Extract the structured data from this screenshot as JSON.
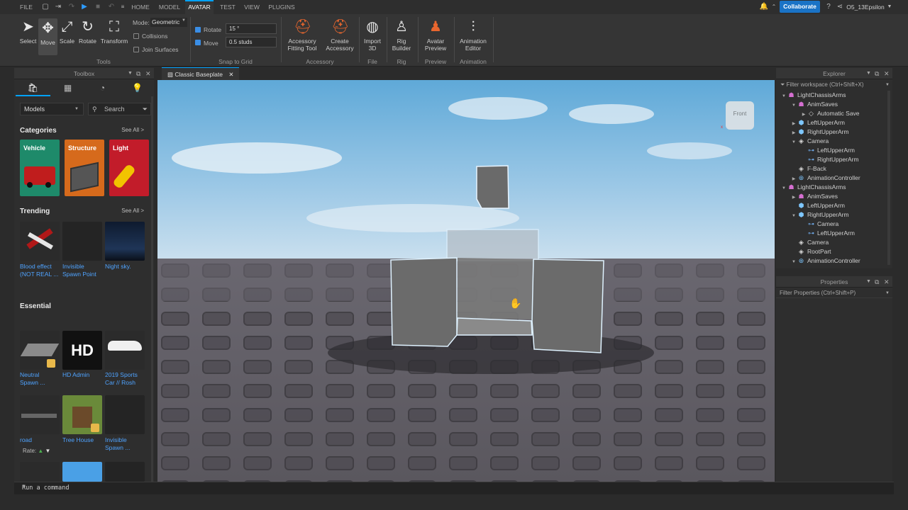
{
  "menubar": {
    "file": "FILE",
    "tabs": [
      "HOME",
      "MODEL",
      "AVATAR",
      "TEST",
      "VIEW",
      "PLUGINS"
    ],
    "active_tab": "AVATAR",
    "collaborate": "Collaborate",
    "user": "O5_13Epsilon"
  },
  "ribbon": {
    "tools": [
      {
        "label": "Select",
        "icon": "cursor-icon"
      },
      {
        "label": "Move",
        "icon": "move-icon"
      },
      {
        "label": "Scale",
        "icon": "scale-icon"
      },
      {
        "label": "Rotate",
        "icon": "rotate-icon"
      },
      {
        "label": "Transform",
        "icon": "transform-icon"
      }
    ],
    "mode_label": "Mode:",
    "mode_value": "Geometric",
    "collisions": "Collisions",
    "join_surfaces": "Join Surfaces",
    "tools_group": "Tools",
    "rotate_label": "Rotate",
    "rotate_value": "15 °",
    "move_label": "Move",
    "move_value": "0.5 studs",
    "snap_group": "Snap to Grid",
    "acc_fitting_1": "Accessory",
    "acc_fitting_2": "Fitting Tool",
    "create_acc_1": "Create",
    "create_acc_2": "Accessory",
    "accessory_group": "Accessory",
    "import_1": "Import",
    "import_2": "3D",
    "file_group": "File",
    "rig_1": "Rig",
    "rig_2": "Builder",
    "rig_group": "Rig",
    "preview_1": "Avatar",
    "preview_2": "Preview",
    "preview_group": "Preview",
    "anim_1": "Animation",
    "anim_2": "Editor",
    "animation_group": "Animation"
  },
  "toolbox": {
    "title": "Toolbox",
    "dropdown": "Models",
    "search_placeholder": "Search",
    "categories_title": "Categories",
    "see_all": "See All >",
    "categories": [
      {
        "label": "Vehicle",
        "color": "#1e8a6a"
      },
      {
        "label": "Structure",
        "color": "#d66a1c"
      },
      {
        "label": "Light",
        "color": "#c21c2a"
      }
    ],
    "trending_title": "Trending",
    "trending": [
      {
        "l1": "Blood effect",
        "l2": "(NOT REAL ..."
      },
      {
        "l1": "Invisible",
        "l2": "Spawn Point"
      },
      {
        "l1": "Night sky.",
        "l2": ""
      }
    ],
    "essential_title": "Essential",
    "essential": [
      {
        "l1": "Neutral",
        "l2": "Spawn ..."
      },
      {
        "l1": "HD Admin",
        "l2": ""
      },
      {
        "l1": "2019 Sports",
        "l2": "Car // Rosh"
      },
      {
        "l1": "road",
        "l2": ""
      },
      {
        "l1": "Tree House",
        "l2": ""
      },
      {
        "l1": "Invisible",
        "l2": "Spawn ..."
      }
    ],
    "rate_label": "Rate:",
    "hd_text": "HD"
  },
  "viewport": {
    "tab": "Classic Baseplate",
    "view_cube": "Front"
  },
  "explorer": {
    "title": "Explorer",
    "filter": "Filter workspace (Ctrl+Shift+X)",
    "rows": [
      {
        "label": "LightChassisArms",
        "indent": 0,
        "arrow": "▼",
        "icon": "model"
      },
      {
        "label": "AnimSaves",
        "indent": 1,
        "arrow": "▼",
        "icon": "model"
      },
      {
        "label": "Automatic Save",
        "indent": 2,
        "arrow": "▶",
        "icon": "keyframe"
      },
      {
        "label": "LeftUpperArm",
        "indent": 1,
        "arrow": "▶",
        "icon": "mesh"
      },
      {
        "label": "RightUpperArm",
        "indent": 1,
        "arrow": "▶",
        "icon": "mesh"
      },
      {
        "label": "Camera",
        "indent": 1,
        "arrow": "▼",
        "icon": "part"
      },
      {
        "label": "LeftUpperArm",
        "indent": 2,
        "arrow": "",
        "icon": "link"
      },
      {
        "label": "RightUpperArm",
        "indent": 2,
        "arrow": "",
        "icon": "link"
      },
      {
        "label": "F-Back",
        "indent": 1,
        "arrow": "",
        "icon": "part"
      },
      {
        "label": "AnimationController",
        "indent": 1,
        "arrow": "▶",
        "icon": "anim"
      },
      {
        "label": "LightChassisArms",
        "indent": 0,
        "arrow": "▼",
        "icon": "model"
      },
      {
        "label": "AnimSaves",
        "indent": 1,
        "arrow": "▶",
        "icon": "model"
      },
      {
        "label": "LeftUpperArm",
        "indent": 1,
        "arrow": "",
        "icon": "mesh"
      },
      {
        "label": "RightUpperArm",
        "indent": 1,
        "arrow": "▼",
        "icon": "mesh"
      },
      {
        "label": "Camera",
        "indent": 2,
        "arrow": "",
        "icon": "link"
      },
      {
        "label": "LeftUpperArm",
        "indent": 2,
        "arrow": "",
        "icon": "link"
      },
      {
        "label": "Camera",
        "indent": 1,
        "arrow": "",
        "icon": "part"
      },
      {
        "label": "RootPart",
        "indent": 1,
        "arrow": "",
        "icon": "part"
      },
      {
        "label": "AnimationController",
        "indent": 1,
        "arrow": "▼",
        "icon": "anim"
      }
    ]
  },
  "properties": {
    "title": "Properties",
    "filter": "Filter Properties (Ctrl+Shift+P)"
  },
  "command": {
    "placeholder": "Run a command"
  }
}
